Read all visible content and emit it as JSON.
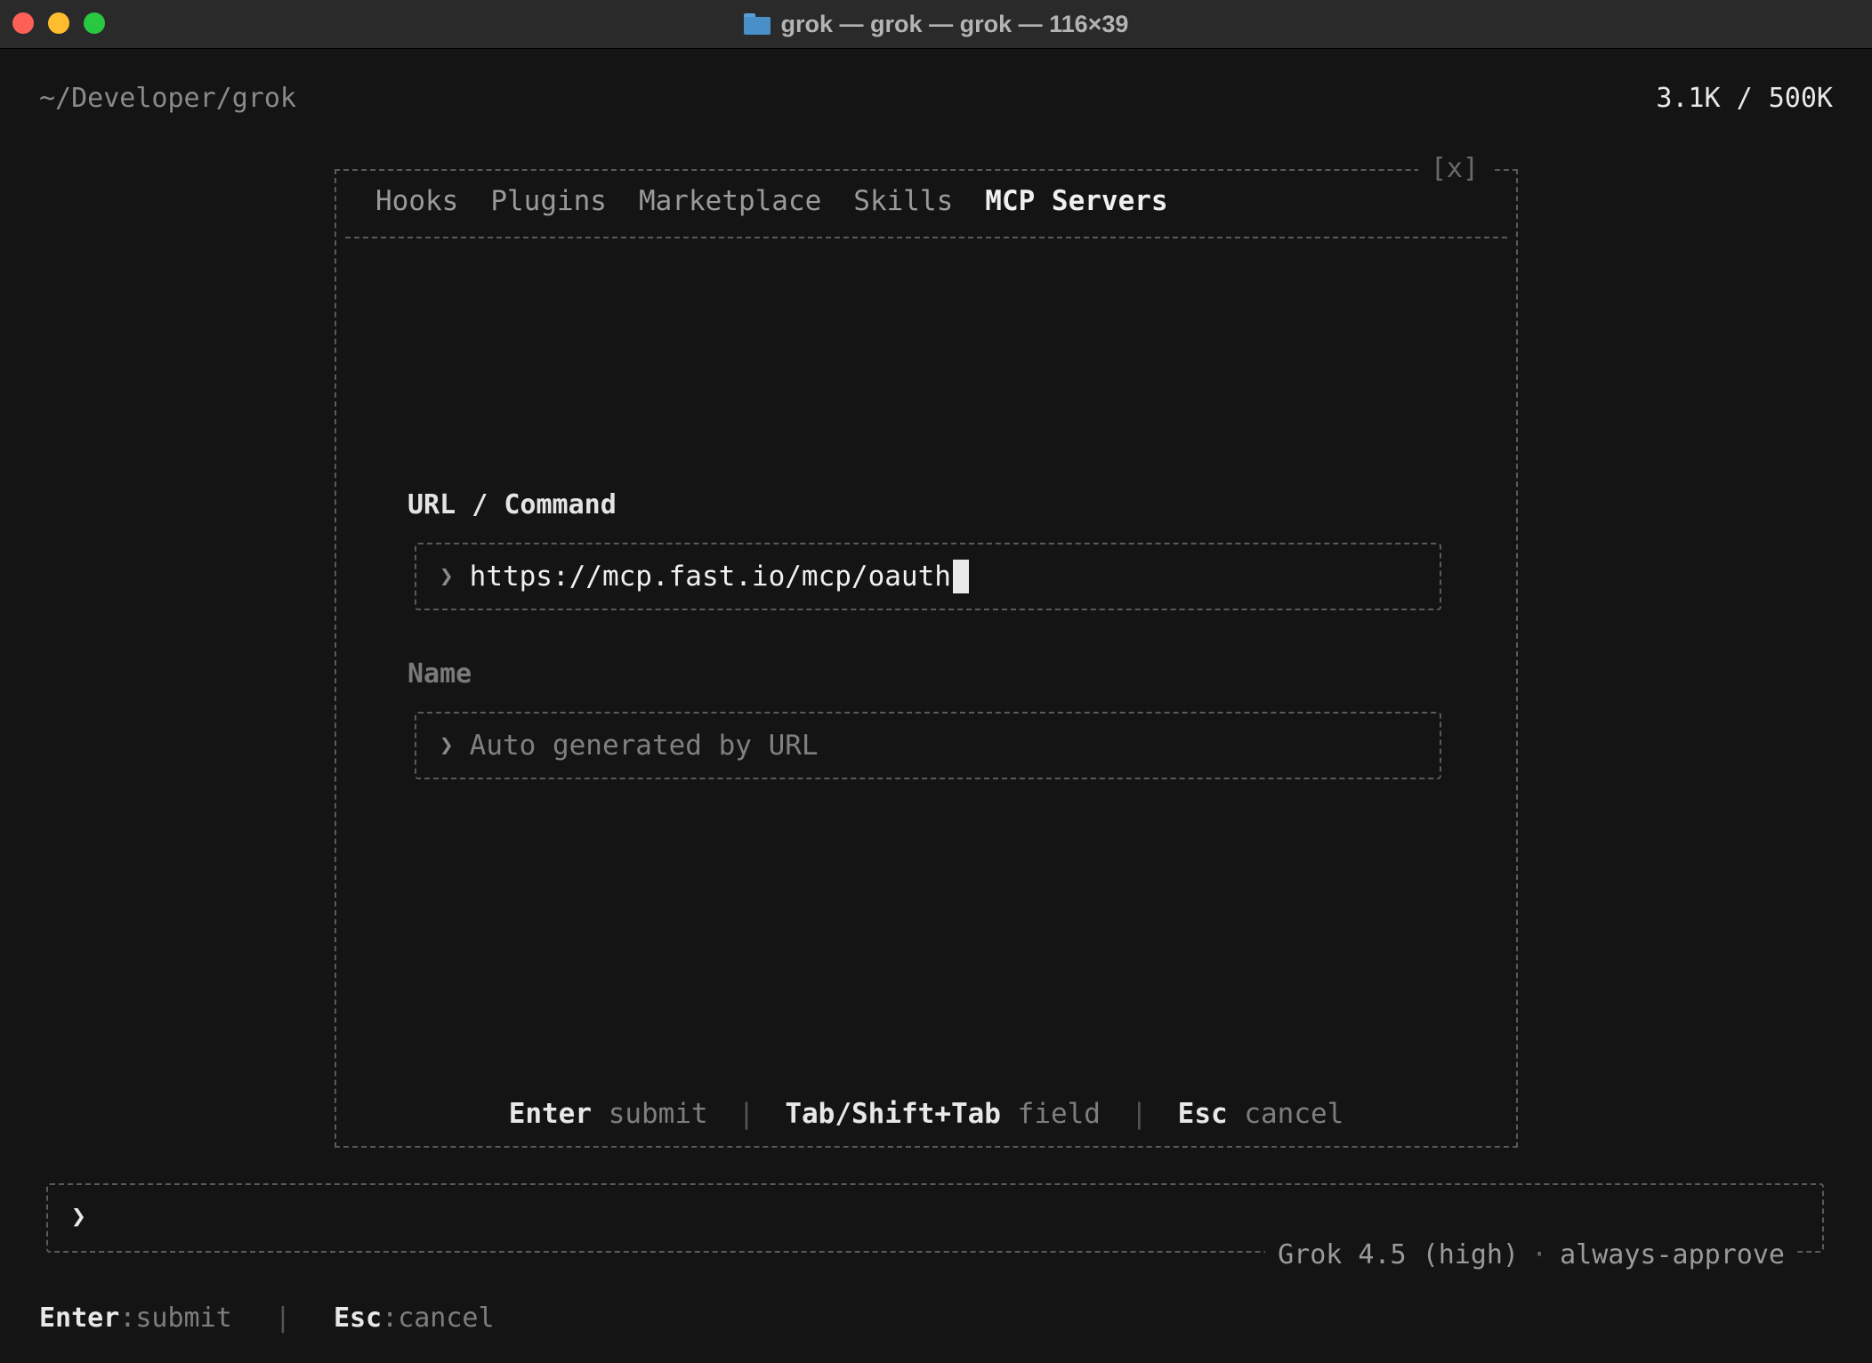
{
  "window": {
    "title": "grok — grok — grok — 116×39",
    "folder_icon": "folder-icon"
  },
  "header": {
    "cwd": "~/Developer/grok",
    "tokens": "3.1K / 500K"
  },
  "dialog": {
    "close_label": "[x]",
    "tabs": [
      {
        "label": "Hooks",
        "active": false
      },
      {
        "label": "Plugins",
        "active": false
      },
      {
        "label": "Marketplace",
        "active": false
      },
      {
        "label": "Skills",
        "active": false
      },
      {
        "label": "MCP Servers",
        "active": true
      }
    ],
    "url_field": {
      "label": "URL / Command",
      "value": "https://mcp.fast.io/mcp/oauth"
    },
    "name_field": {
      "label": "Name",
      "placeholder": "Auto generated by URL"
    },
    "hints": [
      {
        "key": "Enter",
        "action": "submit"
      },
      {
        "key": "Tab/Shift+Tab",
        "action": "field"
      },
      {
        "key": "Esc",
        "action": "cancel"
      }
    ],
    "hint_separator": "|"
  },
  "input": {
    "prompt_glyph": "❯",
    "model": "Grok 4.5 (high)",
    "separator": "·",
    "mode": "always-approve"
  },
  "footer": {
    "hints": [
      {
        "key": "Enter",
        "action": "submit"
      },
      {
        "key": "Esc",
        "action": "cancel"
      }
    ],
    "key_separator": ":",
    "hint_separator": "|"
  },
  "colors": {
    "background": "#141414",
    "titlebar": "#2a2a2a",
    "border": "#5a5a5a",
    "close": "#fe5f57",
    "minimize": "#febc2e",
    "zoom": "#28c840"
  }
}
